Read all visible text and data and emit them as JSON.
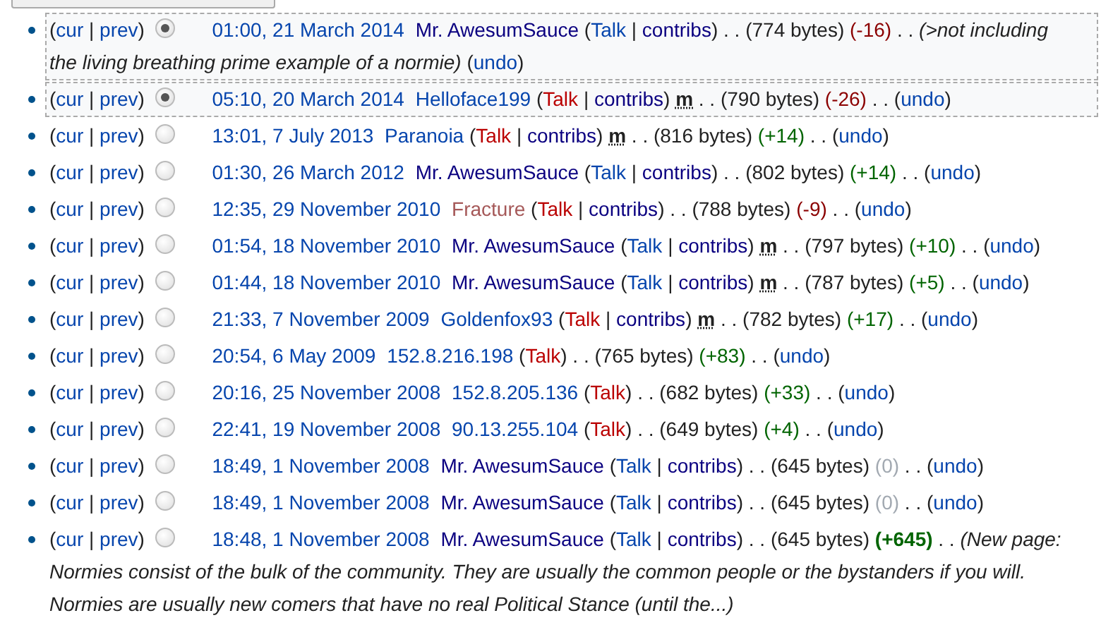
{
  "punctuation": {
    "open": "(",
    "close": ")",
    "pipe": "|",
    "dots": ". ."
  },
  "revisions": [
    {
      "history_links": [
        "cur",
        "prev"
      ],
      "selected": true,
      "highlighted": true,
      "date": "01:00, 21 March 2014",
      "user": {
        "name": "Mr. AwesumSauce",
        "kind": "visited"
      },
      "talk_exists": true,
      "talk": "Talk",
      "contribs": "contribs",
      "bytes": "(774 bytes)",
      "diff": {
        "text": "(-16)",
        "kind": "neg",
        "bold": false
      },
      "comment_lines": [
        "(>not including",
        "the living breathing prime example of a normie)"
      ],
      "undo": "undo"
    },
    {
      "history_links": [
        "cur",
        "prev"
      ],
      "selected": true,
      "highlighted": true,
      "date": "05:10, 20 March 2014",
      "user": {
        "name": "Helloface199",
        "kind": "link"
      },
      "talk_exists": false,
      "talk": "Talk",
      "contribs": "contribs",
      "minor": "m",
      "bytes": "(790 bytes)",
      "diff": {
        "text": "(-26)",
        "kind": "neg",
        "bold": false
      },
      "undo": "undo"
    },
    {
      "history_links": [
        "cur",
        "prev"
      ],
      "selected": false,
      "highlighted": false,
      "date": "13:01, 7 July 2013",
      "user": {
        "name": "Paranoia",
        "kind": "link"
      },
      "talk_exists": false,
      "talk": "Talk",
      "contribs": "contribs",
      "minor": "m",
      "bytes": "(816 bytes)",
      "diff": {
        "text": "(+14)",
        "kind": "pos",
        "bold": false
      },
      "undo": "undo"
    },
    {
      "history_links": [
        "cur",
        "prev"
      ],
      "selected": false,
      "highlighted": false,
      "date": "01:30, 26 March 2012",
      "user": {
        "name": "Mr. AwesumSauce",
        "kind": "visited"
      },
      "talk_exists": true,
      "talk": "Talk",
      "contribs": "contribs",
      "bytes": "(802 bytes)",
      "diff": {
        "text": "(+14)",
        "kind": "pos",
        "bold": false
      },
      "undo": "undo"
    },
    {
      "history_links": [
        "cur",
        "prev"
      ],
      "selected": false,
      "highlighted": false,
      "date": "12:35, 29 November 2010",
      "user": {
        "name": "Fracture",
        "kind": "new_visited"
      },
      "talk_exists": false,
      "talk": "Talk",
      "contribs": "contribs",
      "bytes": "(788 bytes)",
      "diff": {
        "text": "(-9)",
        "kind": "neg",
        "bold": false
      },
      "undo": "undo"
    },
    {
      "history_links": [
        "cur",
        "prev"
      ],
      "selected": false,
      "highlighted": false,
      "date": "01:54, 18 November 2010",
      "user": {
        "name": "Mr. AwesumSauce",
        "kind": "visited"
      },
      "talk_exists": true,
      "talk": "Talk",
      "contribs": "contribs",
      "minor": "m",
      "bytes": "(797 bytes)",
      "diff": {
        "text": "(+10)",
        "kind": "pos",
        "bold": false
      },
      "undo": "undo"
    },
    {
      "history_links": [
        "cur",
        "prev"
      ],
      "selected": false,
      "highlighted": false,
      "date": "01:44, 18 November 2010",
      "user": {
        "name": "Mr. AwesumSauce",
        "kind": "visited"
      },
      "talk_exists": true,
      "talk": "Talk",
      "contribs": "contribs",
      "minor": "m",
      "bytes": "(787 bytes)",
      "diff": {
        "text": "(+5)",
        "kind": "pos",
        "bold": false
      },
      "undo": "undo"
    },
    {
      "history_links": [
        "cur",
        "prev"
      ],
      "selected": false,
      "highlighted": false,
      "date": "21:33, 7 November 2009",
      "user": {
        "name": "Goldenfox93",
        "kind": "link"
      },
      "talk_exists": false,
      "talk": "Talk",
      "contribs": "contribs",
      "minor": "m",
      "bytes": "(782 bytes)",
      "diff": {
        "text": "(+17)",
        "kind": "pos",
        "bold": false
      },
      "undo": "undo"
    },
    {
      "history_links": [
        "cur",
        "prev"
      ],
      "selected": false,
      "highlighted": false,
      "date": "20:54, 6 May 2009",
      "user": {
        "name": "152.8.216.198",
        "kind": "link"
      },
      "talk_exists": false,
      "talk": "Talk",
      "bytes": "(765 bytes)",
      "diff": {
        "text": "(+83)",
        "kind": "pos",
        "bold": false
      },
      "undo": "undo"
    },
    {
      "history_links": [
        "cur",
        "prev"
      ],
      "selected": false,
      "highlighted": false,
      "date": "20:16, 25 November 2008",
      "user": {
        "name": "152.8.205.136",
        "kind": "link"
      },
      "talk_exists": false,
      "talk": "Talk",
      "bytes": "(682 bytes)",
      "diff": {
        "text": "(+33)",
        "kind": "pos",
        "bold": false
      },
      "undo": "undo"
    },
    {
      "history_links": [
        "cur",
        "prev"
      ],
      "selected": false,
      "highlighted": false,
      "date": "22:41, 19 November 2008",
      "user": {
        "name": "90.13.255.104",
        "kind": "link"
      },
      "talk_exists": false,
      "talk": "Talk",
      "bytes": "(649 bytes)",
      "diff": {
        "text": "(+4)",
        "kind": "pos",
        "bold": false
      },
      "undo": "undo"
    },
    {
      "history_links": [
        "cur",
        "prev"
      ],
      "selected": false,
      "highlighted": false,
      "date": "18:49, 1 November 2008",
      "user": {
        "name": "Mr. AwesumSauce",
        "kind": "visited"
      },
      "talk_exists": true,
      "talk": "Talk",
      "contribs": "contribs",
      "bytes": "(645 bytes)",
      "diff": {
        "text": "(0)",
        "kind": "null",
        "bold": false
      },
      "undo": "undo"
    },
    {
      "history_links": [
        "cur",
        "prev"
      ],
      "selected": false,
      "highlighted": false,
      "date": "18:49, 1 November 2008",
      "user": {
        "name": "Mr. AwesumSauce",
        "kind": "visited"
      },
      "talk_exists": true,
      "talk": "Talk",
      "contribs": "contribs",
      "bytes": "(645 bytes)",
      "diff": {
        "text": "(0)",
        "kind": "null",
        "bold": false
      },
      "undo": "undo"
    },
    {
      "history_links": [
        "cur",
        "prev"
      ],
      "selected": false,
      "highlighted": false,
      "date": "18:48, 1 November 2008",
      "user": {
        "name": "Mr. AwesumSauce",
        "kind": "visited"
      },
      "talk_exists": true,
      "talk": "Talk",
      "contribs": "contribs",
      "bytes": "(645 bytes)",
      "diff": {
        "text": "(+645)",
        "kind": "pos",
        "bold": true
      },
      "comment_lines": [
        "(New page:",
        "Normies consist of the bulk of the community. They are usually the common people or the bystanders if you will.",
        "Normies are usually new comers that have no real Political Stance (until the...)"
      ]
    }
  ]
}
